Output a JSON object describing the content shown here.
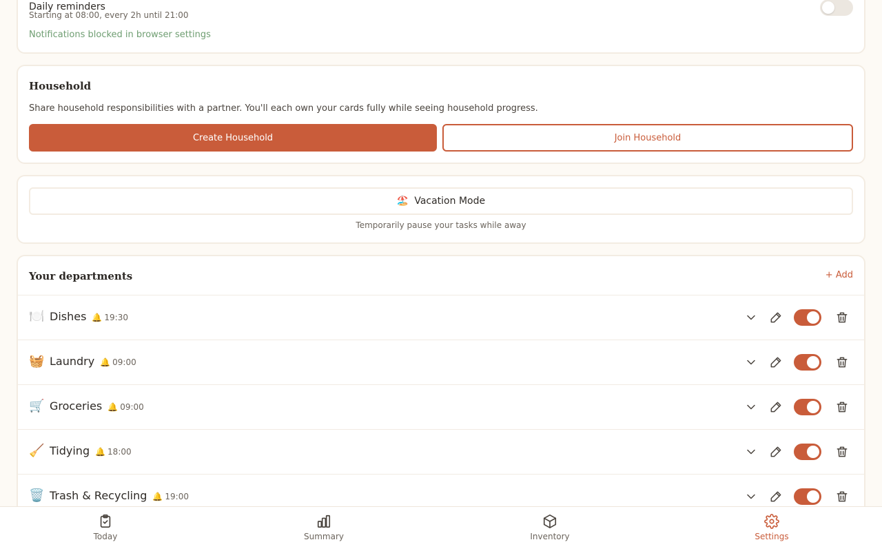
{
  "notifications": {
    "title": "Daily reminders",
    "subtitle": "Starting at 08:00, every 2h until 21:00",
    "blocked": "Notifications blocked in browser settings",
    "enabled": false
  },
  "household": {
    "title": "Household",
    "description": "Share household responsibilities with a partner. You'll each own your cards fully while seeing household progress.",
    "create_label": "Create Household",
    "join_label": "Join Household"
  },
  "vacation": {
    "emoji": "🏖️",
    "label": "Vacation Mode",
    "subtitle": "Temporarily pause your tasks while away"
  },
  "departments": {
    "title": "Your departments",
    "add_label": "+ Add",
    "items": [
      {
        "emoji": "🍽️",
        "name": "Dishes",
        "time": "19:30",
        "enabled": true
      },
      {
        "emoji": "🧺",
        "name": "Laundry",
        "time": "09:00",
        "enabled": true
      },
      {
        "emoji": "🛒",
        "name": "Groceries",
        "time": "09:00",
        "enabled": true
      },
      {
        "emoji": "🧹",
        "name": "Tidying",
        "time": "18:00",
        "enabled": true
      },
      {
        "emoji": "🗑️",
        "name": "Trash & Recycling",
        "time": "19:00",
        "enabled": true
      }
    ]
  },
  "nav": {
    "today": "Today",
    "summary": "Summary",
    "inventory": "Inventory",
    "settings": "Settings",
    "active": "settings"
  },
  "colors": {
    "accent": "#c95c3a",
    "success": "#6f9e72",
    "background": "#fdfaf5"
  }
}
